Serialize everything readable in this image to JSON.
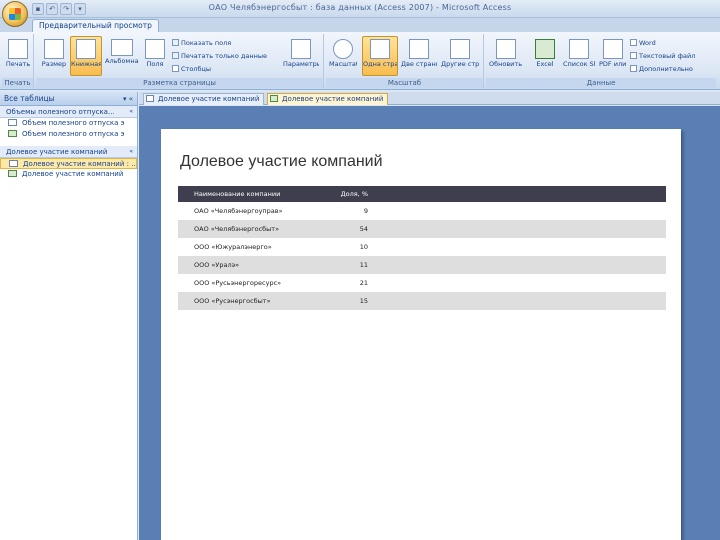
{
  "window": {
    "title": "ОАО Челябэнергосбыт : база данных (Access 2007) - Microsoft Access"
  },
  "ribbon_tab": "Предварительный просмотр",
  "ribbon": {
    "print_group": {
      "label": "Печать",
      "print": "Печать"
    },
    "page_layout_group": {
      "label": "Разметка страницы",
      "size": "Размер",
      "portrait": "Книжная",
      "landscape": "Альбомная",
      "margins": "Поля",
      "print_margins": "Показать поля",
      "print_data_only": "Печатать только данные",
      "columns": "Столбцы",
      "page_setup": "Параметры страницы"
    },
    "zoom_group": {
      "label": "Масштаб",
      "zoom": "Масштаб",
      "one_page": "Одна страница",
      "two_pages": "Две страницы",
      "more_pages": "Другие страницы"
    },
    "data_group": {
      "label": "Данные",
      "refresh_all": "Обновить все",
      "excel": "Excel",
      "sharepoint": "Список SharePoint",
      "pdf_xps": "PDF или XPS",
      "word": "Word",
      "text_file": "Текстовый файл",
      "more": "Дополнительно"
    }
  },
  "nav": {
    "header": "Все таблицы",
    "categories": [
      {
        "name": "Объемы полезного отпуска...",
        "items": [
          {
            "label": "Объем полезного отпуска э",
            "type": "table"
          },
          {
            "label": "Объем полезного отпуска э",
            "type": "report"
          }
        ]
      },
      {
        "name": "Долевое участие компаний",
        "items": [
          {
            "label": "Долевое участие компаний : ...",
            "type": "table"
          },
          {
            "label": "Долевое участие компаний",
            "type": "report"
          }
        ]
      }
    ]
  },
  "doc_tabs": [
    {
      "label": "Долевое участие компаний",
      "type": "table"
    },
    {
      "label": "Долевое участие компаний",
      "type": "report"
    }
  ],
  "report": {
    "title": "Долевое участие компаний",
    "columns": [
      "Наименование компании",
      "Доля, %"
    ],
    "rows": [
      [
        "ОАО «Челябэнергоуправ»",
        "9"
      ],
      [
        "ОАО «Челябэнергосбыт»",
        "54"
      ],
      [
        "ООО «Южуралэнерго»",
        "10"
      ],
      [
        "ООО «Уралэ»",
        "11"
      ],
      [
        "ООО «Русьэнергоресурс»",
        "21"
      ],
      [
        "ООО «Русэнергосбыт»",
        "15"
      ]
    ]
  }
}
